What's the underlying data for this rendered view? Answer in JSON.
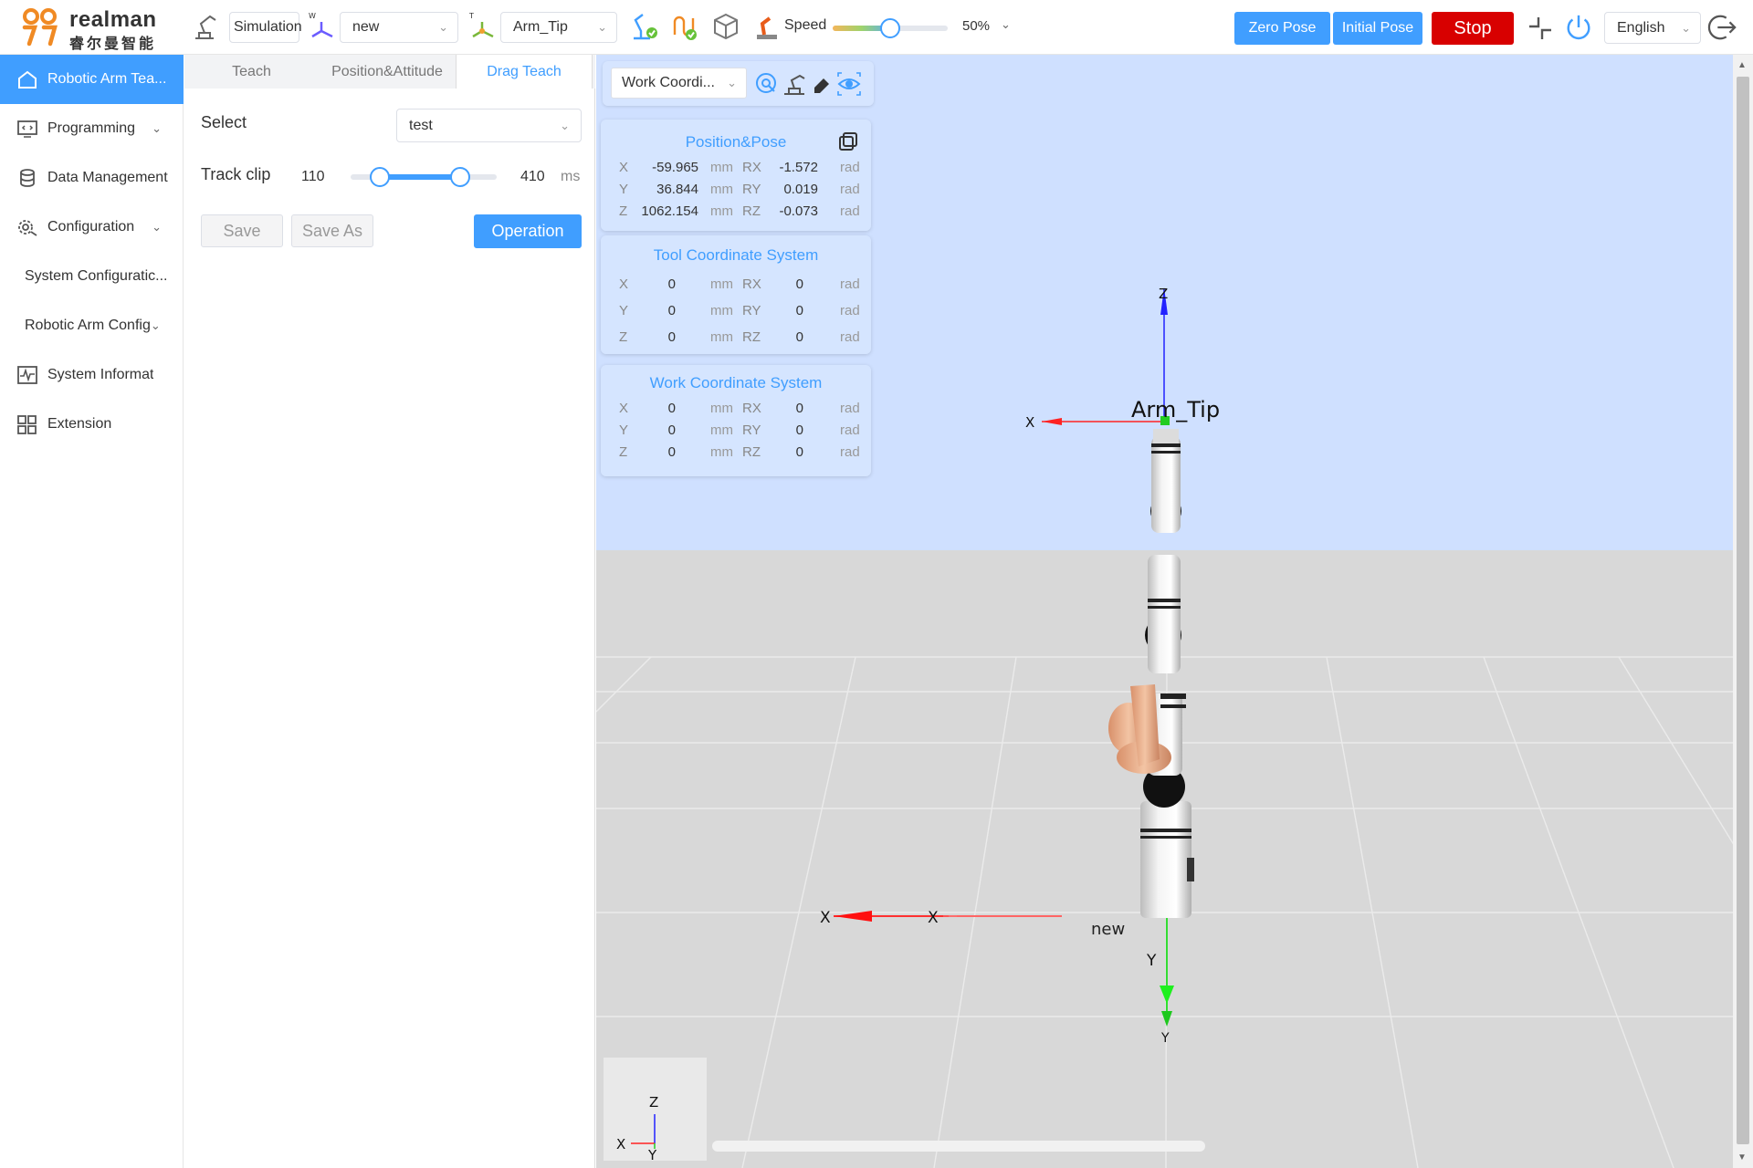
{
  "brand": {
    "name": "realman",
    "subtitle": "睿尔曼智能"
  },
  "toolbar": {
    "mode": "Simulation",
    "work_frame": "new",
    "tool_frame": "Arm_Tip",
    "speed_label": "Speed",
    "speed_value": "50%",
    "speed_fraction": 0.5,
    "zero_pose": "Zero Pose",
    "initial_pose": "Initial Pose",
    "stop": "Stop",
    "language": "English",
    "frame_marker_w": "W",
    "frame_marker_t": "T"
  },
  "sidebar": {
    "items": [
      {
        "label": "Robotic Arm Tea...",
        "icon": "home-icon",
        "active": true
      },
      {
        "label": "Programming",
        "icon": "code-icon",
        "chevron": true
      },
      {
        "label": "Data Management",
        "icon": "database-icon"
      },
      {
        "label": "Configuration",
        "icon": "settings-icon",
        "chevron": true
      },
      {
        "label": "System Configuratic...",
        "sub": true
      },
      {
        "label": "Robotic Arm Config",
        "sub": true,
        "chevron": true
      },
      {
        "label": "System Informat",
        "icon": "pulse-icon"
      },
      {
        "label": "Extension",
        "icon": "grid-icon"
      }
    ]
  },
  "teach_panel": {
    "tabs": [
      "Teach",
      "Position&Attitude",
      "Drag Teach"
    ],
    "active_tab": "Drag Teach",
    "select_label": "Select",
    "select_value": "test",
    "track_clip_label": "Track clip",
    "clip_min": "110",
    "clip_max": "410",
    "clip_unit": "ms",
    "save": "Save",
    "save_as": "Save As",
    "operation": "Operation"
  },
  "viewport": {
    "coord_select": "Work Coordi...",
    "position_pose": {
      "title": "Position&Pose",
      "rows": [
        {
          "axis": "X",
          "value": "-59.965",
          "unit": "mm",
          "raxis": "RX",
          "rvalue": "-1.572",
          "runit": "rad"
        },
        {
          "axis": "Y",
          "value": "36.844",
          "unit": "mm",
          "raxis": "RY",
          "rvalue": "0.019",
          "runit": "rad"
        },
        {
          "axis": "Z",
          "value": "1062.154",
          "unit": "mm",
          "raxis": "RZ",
          "rvalue": "-0.073",
          "runit": "rad"
        }
      ]
    },
    "tool_coord": {
      "title": "Tool Coordinate System",
      "rows": [
        {
          "axis": "X",
          "value": "0",
          "unit": "mm",
          "raxis": "RX",
          "rvalue": "0",
          "runit": "rad"
        },
        {
          "axis": "Y",
          "value": "0",
          "unit": "mm",
          "raxis": "RY",
          "rvalue": "0",
          "runit": "rad"
        },
        {
          "axis": "Z",
          "value": "0",
          "unit": "mm",
          "raxis": "RZ",
          "rvalue": "0",
          "runit": "rad"
        }
      ]
    },
    "work_coord": {
      "title": "Work Coordinate System",
      "rows": [
        {
          "axis": "X",
          "value": "0",
          "unit": "mm",
          "raxis": "RX",
          "rvalue": "0",
          "runit": "rad"
        },
        {
          "axis": "Y",
          "value": "0",
          "unit": "mm",
          "raxis": "RY",
          "rvalue": "0",
          "runit": "rad"
        },
        {
          "axis": "Z",
          "value": "0",
          "unit": "mm",
          "raxis": "RZ",
          "rvalue": "0",
          "runit": "rad"
        }
      ]
    },
    "scene_labels": {
      "arm_tip": "Arm_Tip",
      "work_frame": "new",
      "axis_x": "X",
      "axis_y": "Y",
      "axis_z": "Z"
    }
  },
  "colors": {
    "accent": "#409eff",
    "stop": "#d80000",
    "sky": "#cfe0ff",
    "floor": "#d8d8d8"
  }
}
